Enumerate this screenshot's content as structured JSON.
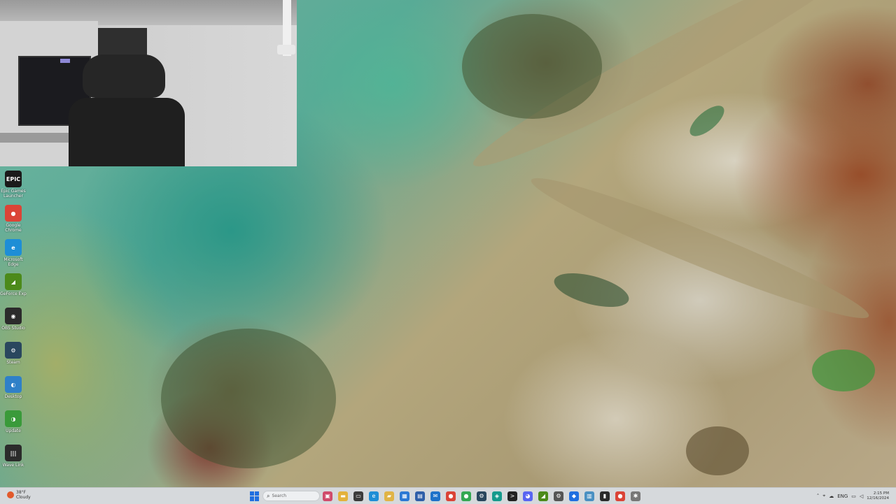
{
  "desktop": {
    "icons": [
      {
        "label": "Epic Games Launcher",
        "glyph": "EPIC",
        "icon": "epic-games-icon",
        "color": "#1a1a1a"
      },
      {
        "label": "Google Chrome",
        "glyph": "●",
        "icon": "chrome-icon",
        "color": "#db4437"
      },
      {
        "label": "Microsoft Edge",
        "glyph": "e",
        "icon": "edge-icon",
        "color": "#1e8ed6"
      },
      {
        "label": "GeForce Exp",
        "glyph": "◢",
        "icon": "nvidia-icon",
        "color": "#4c8a1a"
      },
      {
        "label": "OBS Studio",
        "glyph": "◉",
        "icon": "obs-icon",
        "color": "#2b2b2b"
      },
      {
        "label": "Steam",
        "glyph": "⚙",
        "icon": "steam-icon",
        "color": "#2a475e"
      },
      {
        "label": "Desktop",
        "glyph": "◐",
        "icon": "app-icon",
        "color": "#2f80c8"
      },
      {
        "label": "Update",
        "glyph": "◑",
        "icon": "app-update-icon",
        "color": "#3a9a3a"
      },
      {
        "label": "Wave Link",
        "glyph": "|||",
        "icon": "wave-link-icon",
        "color": "#2b2b2b"
      }
    ]
  },
  "taskbar": {
    "weather": {
      "temp": "38°F",
      "desc": "Cloudy"
    },
    "search_placeholder": "Search",
    "pinned": [
      {
        "icon": "widgets-icon",
        "color": "#d04b6b",
        "glyph": "▣"
      },
      {
        "icon": "file-explorer-icon",
        "color": "#e3b23c",
        "glyph": "▬"
      },
      {
        "icon": "task-view-icon",
        "color": "#3b3b3b",
        "glyph": "▭"
      },
      {
        "icon": "edge-icon",
        "color": "#1e8ed6",
        "glyph": "e"
      },
      {
        "icon": "folder-icon",
        "color": "#e0b447",
        "glyph": "▰"
      },
      {
        "icon": "store-icon",
        "color": "#2b78d4",
        "glyph": "▦"
      },
      {
        "icon": "app-blue-icon",
        "color": "#2f5fa8",
        "glyph": "▤"
      },
      {
        "icon": "mail-icon",
        "color": "#1e72c9",
        "glyph": "✉"
      },
      {
        "icon": "chrome-icon",
        "color": "#db4437",
        "glyph": "●"
      },
      {
        "icon": "chrome-alt-icon",
        "color": "#34a853",
        "glyph": "●"
      },
      {
        "icon": "steam-icon",
        "color": "#2a475e",
        "glyph": "⚙"
      },
      {
        "icon": "app-teal-icon",
        "color": "#159a8c",
        "glyph": "◈"
      },
      {
        "icon": "terminal-icon",
        "color": "#222222",
        "glyph": ">"
      },
      {
        "icon": "discord-icon",
        "color": "#5865f2",
        "glyph": "◕"
      },
      {
        "icon": "nvidia-icon",
        "color": "#4c8a1a",
        "glyph": "◢"
      },
      {
        "icon": "settings-icon",
        "color": "#555555",
        "glyph": "⚙"
      },
      {
        "icon": "security-icon",
        "color": "#1f6fe0",
        "glyph": "◆"
      },
      {
        "icon": "notepad-icon",
        "color": "#4a90c2",
        "glyph": "▥"
      },
      {
        "icon": "app-dark-icon",
        "color": "#2b2b2b",
        "glyph": "▮"
      },
      {
        "icon": "chrome-icon-2",
        "color": "#db4437",
        "glyph": "●"
      },
      {
        "icon": "gear-icon",
        "color": "#777777",
        "glyph": "✱"
      }
    ],
    "tray": {
      "language": "ENG",
      "time": "2:15 PM",
      "date": "12/16/2024"
    }
  }
}
